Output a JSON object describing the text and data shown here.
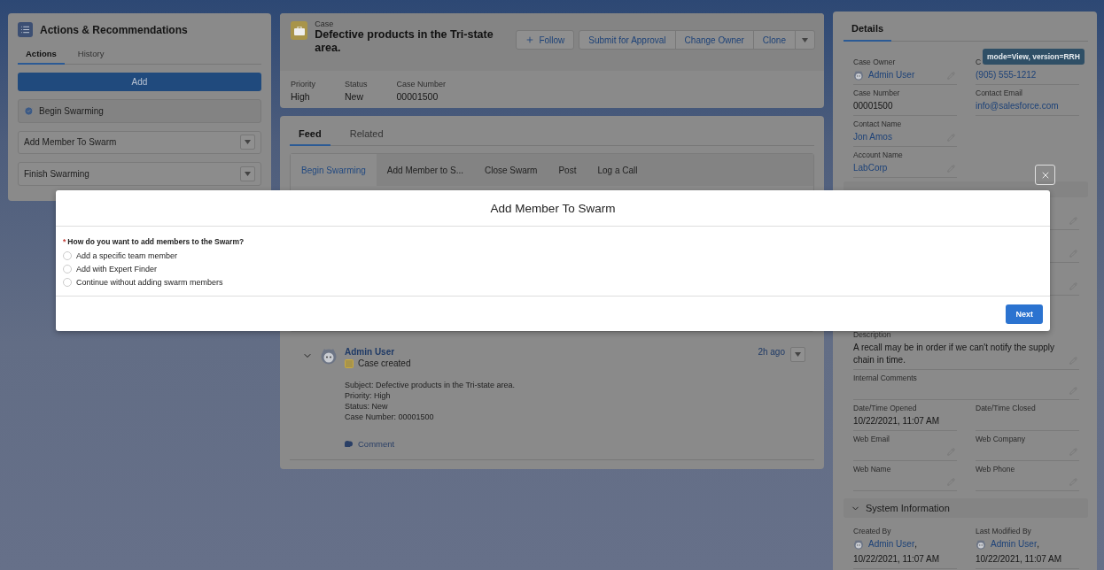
{
  "actions_panel": {
    "title": "Actions & Recommendations",
    "tabs": [
      {
        "label": "Actions",
        "selected": true
      },
      {
        "label": "History",
        "selected": false
      }
    ],
    "add_button": "Add",
    "items": [
      {
        "label": "Begin Swarming",
        "kind": "done"
      },
      {
        "label": "Add Member To Swarm",
        "kind": "menu"
      },
      {
        "label": "Finish Swarming",
        "kind": "menu"
      }
    ]
  },
  "case_header": {
    "object": "Case",
    "title": "Defective products in the Tri-state area.",
    "actions": [
      {
        "label": "Follow",
        "kind": "follow"
      },
      {
        "label": "Submit for Approval",
        "kind": "plain"
      },
      {
        "label": "Change Owner",
        "kind": "plain"
      },
      {
        "label": "Clone",
        "kind": "plain"
      },
      {
        "kind": "menu"
      }
    ],
    "fields": [
      {
        "label": "Priority",
        "value": "High"
      },
      {
        "label": "Status",
        "value": "New"
      },
      {
        "label": "Case Number",
        "value": "00001500"
      }
    ]
  },
  "feed": {
    "tabs": [
      {
        "label": "Feed",
        "selected": true
      },
      {
        "label": "Related",
        "selected": false
      }
    ],
    "publisher_tabs": [
      {
        "label": "Begin Swarming",
        "selected": true
      },
      {
        "label": "Add Member to S...",
        "selected": false
      },
      {
        "label": "Close Swarm",
        "selected": false
      },
      {
        "label": "Post",
        "selected": false
      },
      {
        "label": "Log a Call",
        "selected": false
      }
    ],
    "post": {
      "author": "Admin User",
      "action": "Case created",
      "time": "2h ago",
      "lines": [
        "Subject: Defective products in the Tri-state area.",
        "Priority: High",
        "Status: New",
        "Case Number: 00001500"
      ],
      "comment": "Comment"
    }
  },
  "details": {
    "tabs": [
      {
        "label": "Details",
        "selected": true
      }
    ],
    "tooltip": "mode=View, version=RRH",
    "top_rows": [
      [
        {
          "label": "Case Owner",
          "value": "Admin User",
          "kind": "user",
          "editable": true
        },
        {
          "label": "C",
          "value": "(905) 555-1212",
          "kind": "link",
          "editable": false
        }
      ],
      [
        {
          "label": "Case Number",
          "value": "00001500",
          "kind": "text",
          "editable": false
        },
        {
          "label": "Contact Email",
          "value": "info@salesforce.com",
          "kind": "link",
          "editable": false
        }
      ],
      [
        {
          "label": "Contact Name",
          "value": "Jon Amos",
          "kind": "link",
          "editable": true
        }
      ],
      [
        {
          "label": "Account Name",
          "value": "LabCorp",
          "kind": "link",
          "editable": true
        }
      ]
    ],
    "rows": [
      [
        {
          "label": "Description",
          "value": "A recall may be in order if we can't notify the supply chain in time.",
          "kind": "text",
          "editable": true,
          "wide": true
        }
      ],
      [
        {
          "label": "Internal Comments",
          "kind": "text",
          "editable": true,
          "wide": true
        }
      ],
      [
        {
          "label": "Date/Time Opened",
          "value": "10/22/2021, 11:07 AM",
          "kind": "text",
          "editable": false
        },
        {
          "label": "Date/Time Closed",
          "kind": "text",
          "editable": false
        }
      ],
      [
        {
          "label": "Web Email",
          "kind": "text",
          "editable": true
        },
        {
          "label": "Web Company",
          "kind": "text",
          "editable": true
        }
      ],
      [
        {
          "label": "Web Name",
          "kind": "text",
          "editable": true
        },
        {
          "label": "Web Phone",
          "kind": "text",
          "editable": true
        }
      ]
    ],
    "system_section": {
      "title": "System Information",
      "expanded": true,
      "rows": [
        [
          {
            "label": "Created By",
            "value": "Admin User",
            "suffix": ",",
            "date": "10/22/2021, 11:07 AM",
            "kind": "user_date",
            "editable": false
          },
          {
            "label": "Last Modified By",
            "value": "Admin User",
            "suffix": ",",
            "date": "10/22/2021, 11:07 AM",
            "kind": "user_date",
            "editable": false
          }
        ]
      ]
    }
  },
  "modal": {
    "title": "Add Member To Swarm",
    "question": "How do you want to add members to the Swarm?",
    "required_mark": "*",
    "options": [
      {
        "label": "Add a specific team member",
        "selected": false
      },
      {
        "label": "Add with Expert Finder",
        "selected": false
      },
      {
        "label": "Continue without adding swarm members",
        "selected": false
      }
    ],
    "next_button": "Next"
  }
}
